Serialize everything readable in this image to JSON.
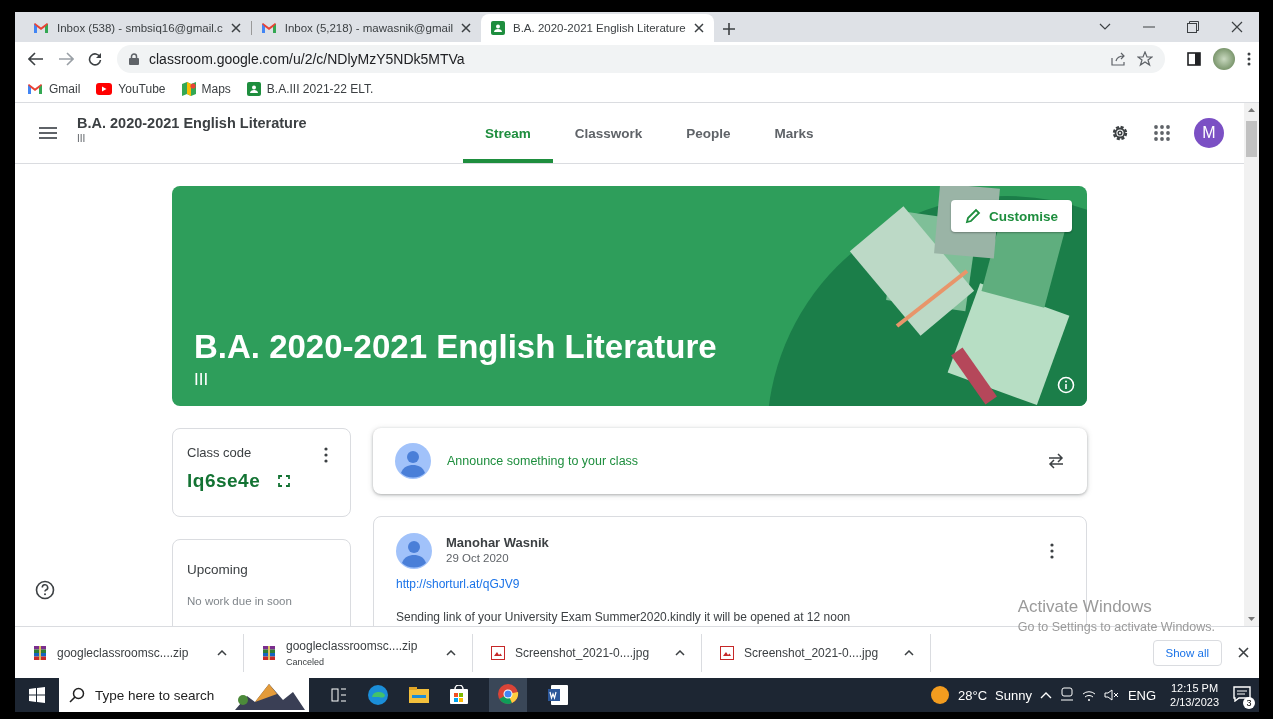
{
  "browser": {
    "tabs": [
      {
        "title": "Inbox (538) - smbsiq16@gmail.c",
        "kind": "mail",
        "selected": false
      },
      {
        "title": "Inbox (5,218) - mawasnik@gmail",
        "kind": "mail",
        "selected": false
      },
      {
        "title": "B.A. 2020-2021 English Literature",
        "kind": "classroom",
        "selected": true
      }
    ],
    "url": "classroom.google.com/u/2/c/NDlyMzY5NDk5MTVa",
    "bookmarks": [
      {
        "label": "Gmail",
        "kind": "mail"
      },
      {
        "label": "YouTube",
        "kind": "video"
      },
      {
        "label": "Maps",
        "kind": "map"
      },
      {
        "label": "B.A.III 2021-22 ELT.",
        "kind": "classroom"
      }
    ]
  },
  "class_header": {
    "title": "B.A. 2020-2021 English Literature",
    "section": "III",
    "avatar": "M",
    "tabs": [
      {
        "label": "Stream",
        "selected": true
      },
      {
        "label": "Classwork",
        "selected": false
      },
      {
        "label": "People",
        "selected": false
      },
      {
        "label": "Marks",
        "selected": false
      }
    ]
  },
  "banner": {
    "title": "B.A. 2020-2021 English Literature",
    "section": "III",
    "customise_button": "Customise"
  },
  "class_code": {
    "label": "Class code",
    "code": "lq6se4e"
  },
  "upcoming": {
    "title": "Upcoming",
    "message": "No work due in soon"
  },
  "announce": {
    "prompt": "Announce something to your class"
  },
  "post": {
    "author": "Manohar Wasnik",
    "date": "29 Oct 2020",
    "link": "http://shorturl.at/qGJV9",
    "text": "Sending link of your University Exam Summer2020.kindly it will be opened at 12 noon"
  },
  "activation": {
    "title": "Activate Windows",
    "message": "Go to Settings to activate Windows."
  },
  "downloads": {
    "show_all": "Show all",
    "items": [
      {
        "name": "googleclassroomsc....zip",
        "kind": "archive"
      },
      {
        "name": "googleclassroomsc....zip",
        "kind": "archive",
        "status": "Canceled"
      },
      {
        "name": "Screenshot_2021-0....jpg",
        "kind": "image"
      },
      {
        "name": "Screenshot_2021-0....jpg",
        "kind": "image"
      }
    ]
  },
  "taskbar": {
    "search_placeholder": "Type here to search",
    "temperature": "28°C",
    "weather": "Sunny",
    "language": "ENG",
    "time": "12:15 PM",
    "date": "2/13/2023",
    "notifications": "3"
  }
}
